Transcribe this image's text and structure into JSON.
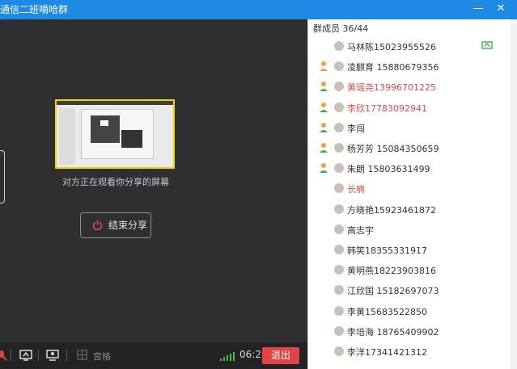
{
  "window": {
    "title": "通信二班嘀哈群",
    "minimize_symbol": "—",
    "close_symbol": "✕"
  },
  "sharing": {
    "status_text": "对方正在观看你分享的屏幕",
    "end_button_label": "结束分享"
  },
  "toolbar": {
    "grid_label": "宫格",
    "timer": "06:21",
    "exit_label": "退出"
  },
  "members": {
    "header": "群成员 36/44",
    "items": [
      {
        "name": "马林陈15023955526",
        "role": "",
        "highlight": false,
        "screen": true
      },
      {
        "name": "凌麒育 15880679356",
        "role": "user-icon",
        "highlight": false,
        "screen": false
      },
      {
        "name": "黄瑶尧13996701225",
        "role": "user-green-icon",
        "highlight": true,
        "screen": false
      },
      {
        "name": "李欣17783092941",
        "role": "user-green-icon",
        "highlight": true,
        "screen": false
      },
      {
        "name": "李闯",
        "role": "user-green-icon",
        "highlight": false,
        "screen": false
      },
      {
        "name": "杨芳芳  15084350659",
        "role": "user-green-icon",
        "highlight": false,
        "screen": false
      },
      {
        "name": "朱朗  15803631499",
        "role": "user-green-icon",
        "highlight": false,
        "screen": false
      },
      {
        "name": "长楠",
        "role": "",
        "highlight": true,
        "screen": false
      },
      {
        "name": "方晓艳15923461872",
        "role": "",
        "highlight": false,
        "screen": false
      },
      {
        "name": "高志宇",
        "role": "",
        "highlight": false,
        "screen": false
      },
      {
        "name": "韩笑18355331917",
        "role": "",
        "highlight": false,
        "screen": false
      },
      {
        "name": "黄明燕18223903816",
        "role": "",
        "highlight": false,
        "screen": false
      },
      {
        "name": "江欣国  15182697073",
        "role": "",
        "highlight": false,
        "screen": false
      },
      {
        "name": "李黄15683522850",
        "role": "",
        "highlight": false,
        "screen": false
      },
      {
        "name": "李培海 18765409902",
        "role": "",
        "highlight": false,
        "screen": false
      },
      {
        "name": "李洋17341421312",
        "role": "",
        "highlight": false,
        "screen": false
      }
    ]
  },
  "colors": {
    "title_bar": "#1e8ae3",
    "exit_button": "#e04545",
    "highlight_name": "#e14b4b",
    "thumbnail_border": "#f2d400"
  }
}
